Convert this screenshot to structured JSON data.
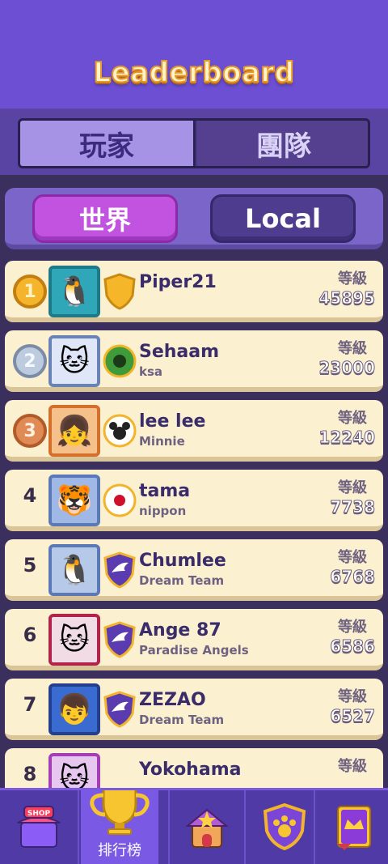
{
  "header": {
    "title": "Leaderboard"
  },
  "tabs": {
    "players": "玩家",
    "teams": "團隊"
  },
  "scope": {
    "world": "世界",
    "local": "Local"
  },
  "level_label": "等級",
  "rows": [
    {
      "rank": "1",
      "name": "Piper21",
      "team": "",
      "level": "45895",
      "avatar": "penguin"
    },
    {
      "rank": "2",
      "name": "Sehaam",
      "team": "ksa",
      "level": "23000",
      "avatar": "white-cat"
    },
    {
      "rank": "3",
      "name": "lee lee",
      "team": "Minnie",
      "level": "12240",
      "avatar": "girl"
    },
    {
      "rank": "4",
      "name": "tama",
      "team": "nippon",
      "level": "7738",
      "avatar": "orange-cat"
    },
    {
      "rank": "5",
      "name": "Chumlee",
      "team": "Dream Team",
      "level": "6768",
      "avatar": "penguin"
    },
    {
      "rank": "6",
      "name": "Ange 87",
      "team": "Paradise Angels",
      "level": "6586",
      "avatar": "white-cat"
    },
    {
      "rank": "7",
      "name": "ZEZAO",
      "team": "Dream Team",
      "level": "6527",
      "avatar": "boy"
    },
    {
      "rank": "8",
      "name": "Yokohama",
      "team": "",
      "level": "",
      "avatar": "white-cat"
    }
  ],
  "nav": {
    "shop": "SHOP",
    "leaderboard": "排行榜"
  }
}
